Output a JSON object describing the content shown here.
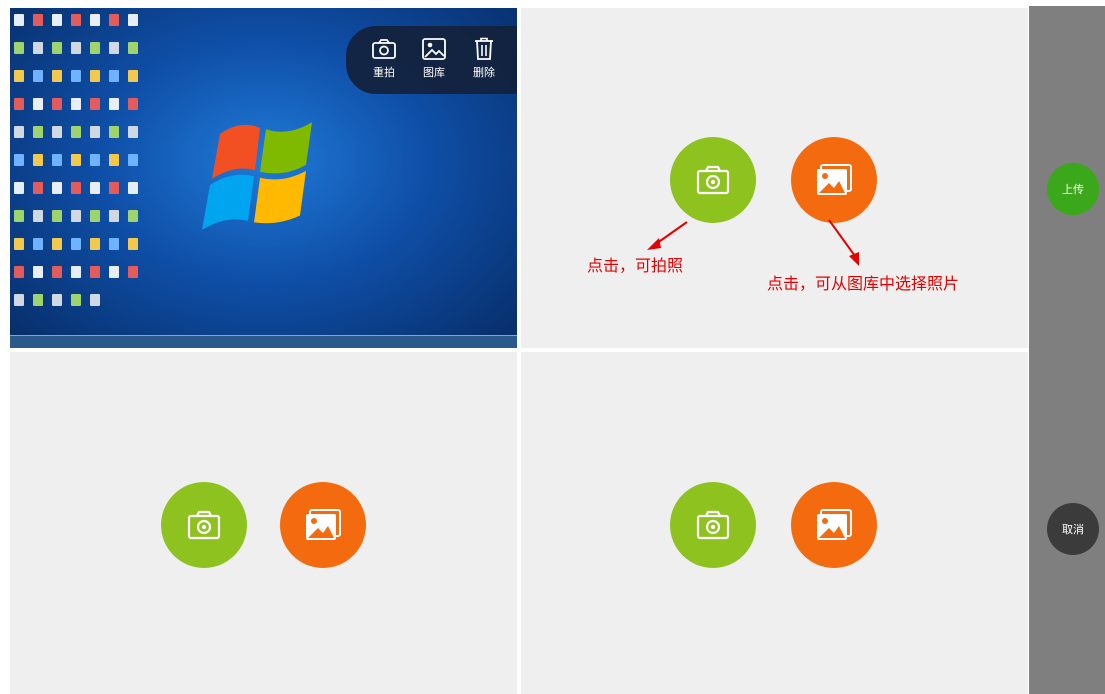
{
  "preview_toolbar": {
    "retake_label": "重拍",
    "gallery_label": "图库",
    "delete_label": "删除"
  },
  "annotations": {
    "camera_hint": "点击，可拍照",
    "gallery_hint": "点击，可从图库中选择照片"
  },
  "sidebar": {
    "upload_label": "上传",
    "cancel_label": "取消"
  },
  "icons": {
    "camera": "camera-icon",
    "gallery": "image-icon",
    "retake": "camera-outline-icon",
    "delete": "trash-icon"
  },
  "colors": {
    "camera_button": "#8dc21f",
    "gallery_button": "#f46b0f",
    "upload_button": "#3aa81a",
    "cancel_button": "#3b3b3b",
    "annotation": "#e60000",
    "sidebar": "#7f7f7f"
  }
}
